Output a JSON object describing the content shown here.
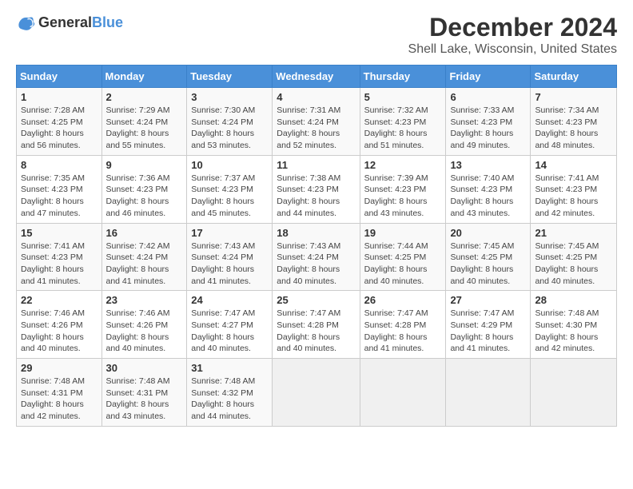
{
  "logo": {
    "text_general": "General",
    "text_blue": "Blue"
  },
  "title": "December 2024",
  "subtitle": "Shell Lake, Wisconsin, United States",
  "header_color": "#4a90d9",
  "days_of_week": [
    "Sunday",
    "Monday",
    "Tuesday",
    "Wednesday",
    "Thursday",
    "Friday",
    "Saturday"
  ],
  "weeks": [
    [
      {
        "day": "1",
        "sunrise": "7:28 AM",
        "sunset": "4:25 PM",
        "daylight": "8 hours and 56 minutes."
      },
      {
        "day": "2",
        "sunrise": "7:29 AM",
        "sunset": "4:24 PM",
        "daylight": "8 hours and 55 minutes."
      },
      {
        "day": "3",
        "sunrise": "7:30 AM",
        "sunset": "4:24 PM",
        "daylight": "8 hours and 53 minutes."
      },
      {
        "day": "4",
        "sunrise": "7:31 AM",
        "sunset": "4:24 PM",
        "daylight": "8 hours and 52 minutes."
      },
      {
        "day": "5",
        "sunrise": "7:32 AM",
        "sunset": "4:23 PM",
        "daylight": "8 hours and 51 minutes."
      },
      {
        "day": "6",
        "sunrise": "7:33 AM",
        "sunset": "4:23 PM",
        "daylight": "8 hours and 49 minutes."
      },
      {
        "day": "7",
        "sunrise": "7:34 AM",
        "sunset": "4:23 PM",
        "daylight": "8 hours and 48 minutes."
      }
    ],
    [
      {
        "day": "8",
        "sunrise": "7:35 AM",
        "sunset": "4:23 PM",
        "daylight": "8 hours and 47 minutes."
      },
      {
        "day": "9",
        "sunrise": "7:36 AM",
        "sunset": "4:23 PM",
        "daylight": "8 hours and 46 minutes."
      },
      {
        "day": "10",
        "sunrise": "7:37 AM",
        "sunset": "4:23 PM",
        "daylight": "8 hours and 45 minutes."
      },
      {
        "day": "11",
        "sunrise": "7:38 AM",
        "sunset": "4:23 PM",
        "daylight": "8 hours and 44 minutes."
      },
      {
        "day": "12",
        "sunrise": "7:39 AM",
        "sunset": "4:23 PM",
        "daylight": "8 hours and 43 minutes."
      },
      {
        "day": "13",
        "sunrise": "7:40 AM",
        "sunset": "4:23 PM",
        "daylight": "8 hours and 43 minutes."
      },
      {
        "day": "14",
        "sunrise": "7:41 AM",
        "sunset": "4:23 PM",
        "daylight": "8 hours and 42 minutes."
      }
    ],
    [
      {
        "day": "15",
        "sunrise": "7:41 AM",
        "sunset": "4:23 PM",
        "daylight": "8 hours and 41 minutes."
      },
      {
        "day": "16",
        "sunrise": "7:42 AM",
        "sunset": "4:24 PM",
        "daylight": "8 hours and 41 minutes."
      },
      {
        "day": "17",
        "sunrise": "7:43 AM",
        "sunset": "4:24 PM",
        "daylight": "8 hours and 41 minutes."
      },
      {
        "day": "18",
        "sunrise": "7:43 AM",
        "sunset": "4:24 PM",
        "daylight": "8 hours and 40 minutes."
      },
      {
        "day": "19",
        "sunrise": "7:44 AM",
        "sunset": "4:25 PM",
        "daylight": "8 hours and 40 minutes."
      },
      {
        "day": "20",
        "sunrise": "7:45 AM",
        "sunset": "4:25 PM",
        "daylight": "8 hours and 40 minutes."
      },
      {
        "day": "21",
        "sunrise": "7:45 AM",
        "sunset": "4:25 PM",
        "daylight": "8 hours and 40 minutes."
      }
    ],
    [
      {
        "day": "22",
        "sunrise": "7:46 AM",
        "sunset": "4:26 PM",
        "daylight": "8 hours and 40 minutes."
      },
      {
        "day": "23",
        "sunrise": "7:46 AM",
        "sunset": "4:26 PM",
        "daylight": "8 hours and 40 minutes."
      },
      {
        "day": "24",
        "sunrise": "7:47 AM",
        "sunset": "4:27 PM",
        "daylight": "8 hours and 40 minutes."
      },
      {
        "day": "25",
        "sunrise": "7:47 AM",
        "sunset": "4:28 PM",
        "daylight": "8 hours and 40 minutes."
      },
      {
        "day": "26",
        "sunrise": "7:47 AM",
        "sunset": "4:28 PM",
        "daylight": "8 hours and 41 minutes."
      },
      {
        "day": "27",
        "sunrise": "7:47 AM",
        "sunset": "4:29 PM",
        "daylight": "8 hours and 41 minutes."
      },
      {
        "day": "28",
        "sunrise": "7:48 AM",
        "sunset": "4:30 PM",
        "daylight": "8 hours and 42 minutes."
      }
    ],
    [
      {
        "day": "29",
        "sunrise": "7:48 AM",
        "sunset": "4:31 PM",
        "daylight": "8 hours and 42 minutes."
      },
      {
        "day": "30",
        "sunrise": "7:48 AM",
        "sunset": "4:31 PM",
        "daylight": "8 hours and 43 minutes."
      },
      {
        "day": "31",
        "sunrise": "7:48 AM",
        "sunset": "4:32 PM",
        "daylight": "8 hours and 44 minutes."
      },
      null,
      null,
      null,
      null
    ]
  ],
  "labels": {
    "sunrise": "Sunrise: ",
    "sunset": "Sunset: ",
    "daylight": "Daylight: "
  }
}
